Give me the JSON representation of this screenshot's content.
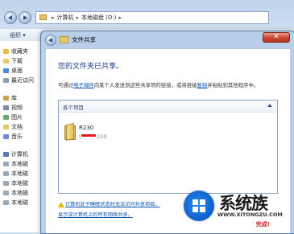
{
  "explorer": {
    "breadcrumb": [
      "计算机",
      "本地磁盘 (D:)"
    ],
    "toolbar": {
      "organize_label": "组织 ▾"
    },
    "nav_items": [
      {
        "label": "收藏夹",
        "icon": "star-icon"
      },
      {
        "label": "下载",
        "icon": "download-folder-icon"
      },
      {
        "label": "桌面",
        "icon": "desktop-icon"
      },
      {
        "label": "最近访问",
        "icon": "recent-places-icon"
      },
      {
        "label": "库",
        "icon": "library-icon"
      },
      {
        "label": "视频",
        "icon": "video-library-icon"
      },
      {
        "label": "图片",
        "icon": "pictures-library-icon"
      },
      {
        "label": "文档",
        "icon": "documents-library-icon"
      },
      {
        "label": "音乐",
        "icon": "music-library-icon"
      },
      {
        "label": "计算机",
        "icon": "computer-icon"
      },
      {
        "label": "本地磁",
        "icon": "drive-icon"
      },
      {
        "label": "本地磁",
        "icon": "drive-icon"
      },
      {
        "label": "本地磁",
        "icon": "drive-icon"
      },
      {
        "label": "本地磁",
        "icon": "drive-icon"
      },
      {
        "label": "本地磁",
        "icon": "drive-icon"
      }
    ]
  },
  "dialog": {
    "title": "文件共享",
    "close_glyph": "✕",
    "heading": "您的文件夹已共享。",
    "description": {
      "prefix": "可通过",
      "email_link": "电子邮件",
      "middle": "向某个人发送到这些共享项的链接，或将链接",
      "copy_link": "复制",
      "suffix": "并粘贴到其他程序中。"
    },
    "list_header": "各个项目",
    "shared_item": {
      "name": "R230",
      "path_prefix": "\\",
      "path_suffix": "230"
    },
    "footer_links": [
      "计算机处于睡眠状态时无法访问共享项目。",
      "显示该计算机上的所有网络共享。"
    ],
    "done_label": "完成!"
  },
  "watermark": {
    "brand": "系统族",
    "url": "WWW.XITONGZU.COM"
  },
  "colors": {
    "accent": "#0b58b8",
    "heading": "#1e3f8e",
    "redaction": "#e01818"
  }
}
